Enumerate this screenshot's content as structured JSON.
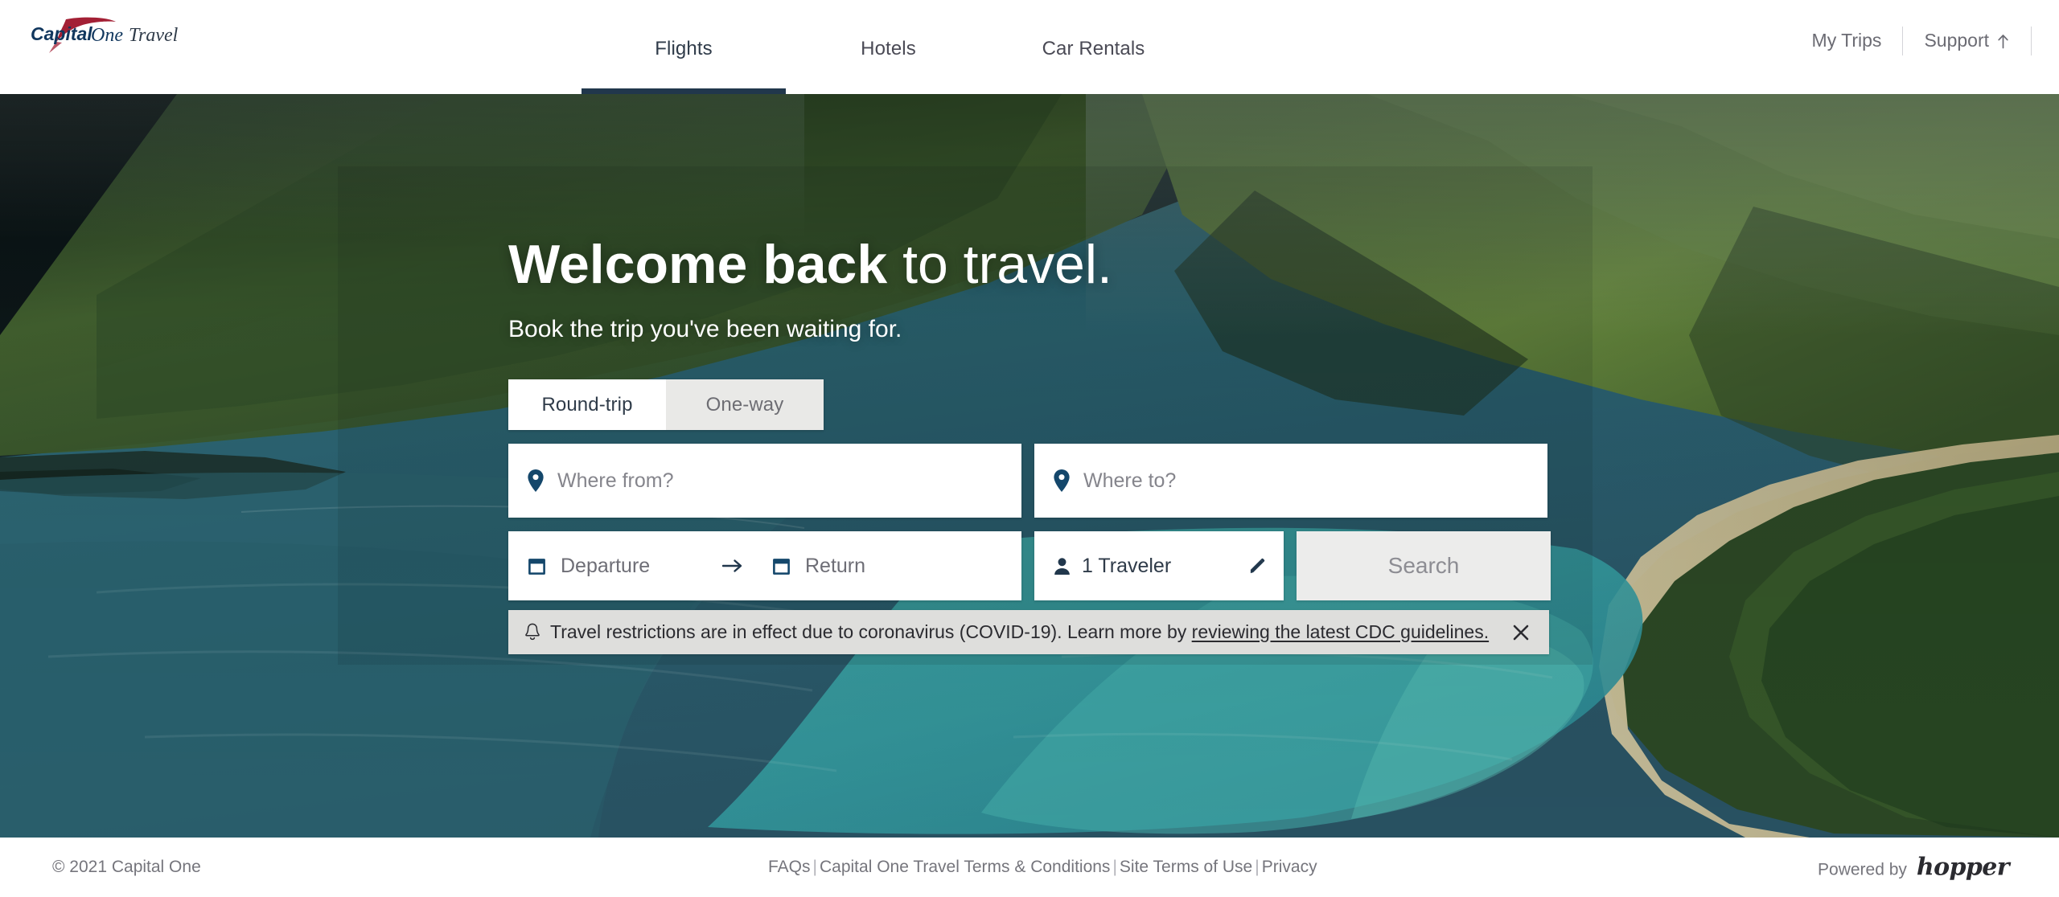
{
  "header": {
    "logo": {
      "name": "capital-one-travel-logo",
      "primary_text": "Capital",
      "secondary_text": "One",
      "suffix_text": "Travel",
      "swoosh_color": "#a32035",
      "wordmark_color": "#11375e"
    },
    "nav": [
      {
        "label": "Flights",
        "active": true
      },
      {
        "label": "Hotels",
        "active": false
      },
      {
        "label": "Car Rentals",
        "active": false
      }
    ],
    "active_indicator_color": "#21374c",
    "right": {
      "my_trips_label": "My Trips",
      "support_label": "Support",
      "support_icon": "external-link-arrow-icon"
    }
  },
  "hero": {
    "headline_bold": "Welcome back",
    "headline_light": " to travel.",
    "subheadline": "Book the trip you've been waiting for.",
    "background_description": "aerial-tropical-coastline-photo"
  },
  "search": {
    "trip_type": {
      "options": [
        "Round-trip",
        "One-way"
      ],
      "selected": "Round-trip"
    },
    "origin": {
      "placeholder": "Where from?",
      "value": "",
      "icon": "location-pin-icon"
    },
    "destination": {
      "placeholder": "Where to?",
      "value": "",
      "icon": "location-pin-icon"
    },
    "departure": {
      "placeholder": "Departure",
      "value": "",
      "icon": "calendar-icon"
    },
    "return": {
      "placeholder": "Return",
      "value": "",
      "icon": "calendar-icon"
    },
    "date_separator_icon": "arrow-right-icon",
    "travelers": {
      "label": "1 Traveler",
      "icon": "person-icon",
      "edit_icon": "pencil-icon"
    },
    "search_button": {
      "label": "Search",
      "disabled": true,
      "background": "#ececeb",
      "text_color": "#8d8d93"
    }
  },
  "banner": {
    "icon": "alert-bell-icon",
    "text_before": "Travel restrictions are in effect due to coronavirus (COVID-19). Learn more by ",
    "link_text": "reviewing the latest CDC guidelines.",
    "close_icon": "close-x-icon",
    "background": "#dededc"
  },
  "footer": {
    "copyright": "© 2021 Capital One",
    "links": [
      "FAQs",
      "Capital One Travel Terms & Conditions",
      "Site Terms of Use",
      "Privacy"
    ],
    "link_separator": "|",
    "powered_by_label": "Powered by",
    "powered_by_brand": "hopper"
  }
}
